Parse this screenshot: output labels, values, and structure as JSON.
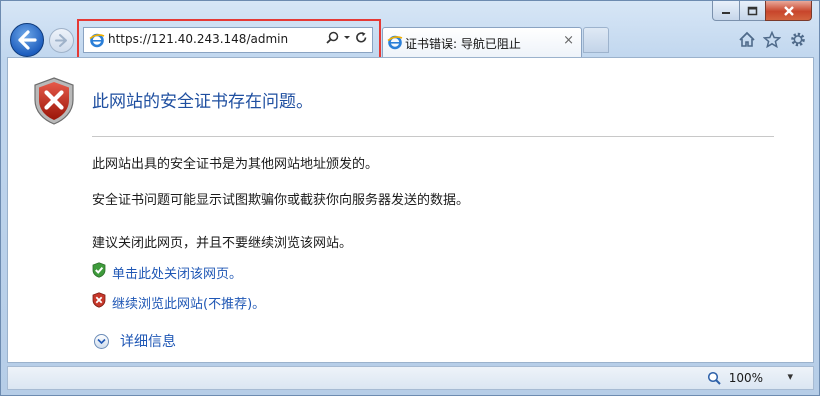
{
  "browser": {
    "address": {
      "url": "https://121.40.243.148/admin",
      "search_icon": "search-icon",
      "dropdown_icon": "chevron-down-icon",
      "refresh_icon": "refresh-icon"
    },
    "tab": {
      "title": "证书错误: 导航已阻止",
      "close_glyph": "×"
    },
    "toolbar_icons": [
      "home-icon",
      "star-icon",
      "gear-icon"
    ],
    "window_buttons": [
      "minimize-icon",
      "maximize-icon",
      "close-icon"
    ]
  },
  "page": {
    "heading": "此网站的安全证书存在问题。",
    "paragraph_1": "此网站出具的安全证书是为其他网站地址颁发的。",
    "paragraph_2": "安全证书问题可能显示试图欺骗你或截获你向服务器发送的数据。",
    "paragraph_3": "建议关闭此网页，并且不要继续浏览该网站。",
    "link_close": "单击此处关闭该网页。",
    "link_continue": "继续浏览此网站(不推荐)。",
    "more_info": "详细信息"
  },
  "status_bar": {
    "zoom": "100%",
    "zoom_dropdown": "▾"
  },
  "colors": {
    "link": "#1f57b5",
    "heading": "#1f4fa0",
    "highlight_box": "#e53935"
  }
}
